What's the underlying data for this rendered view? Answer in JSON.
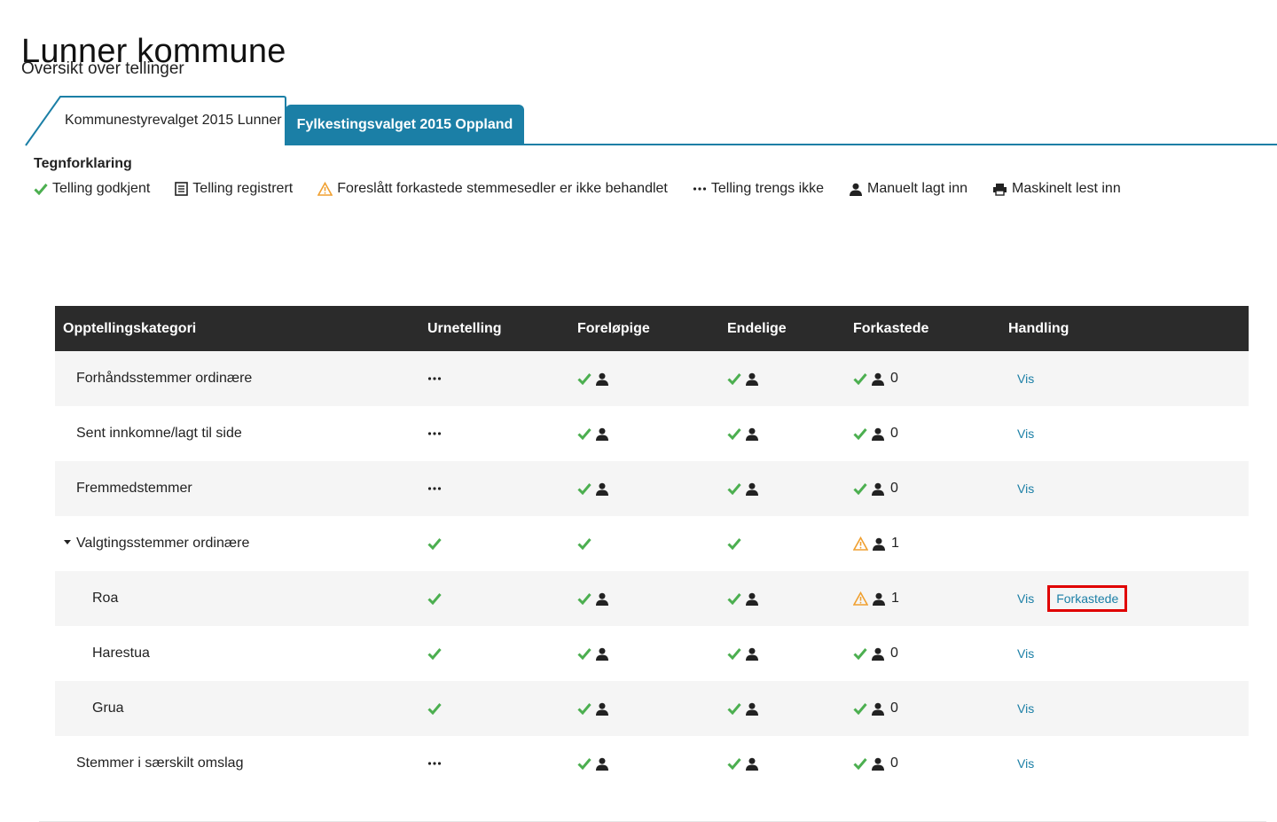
{
  "header": {
    "title": "Lunner kommune",
    "subtitle": "Oversikt over tellinger"
  },
  "tabs": [
    {
      "label": "Kommunestyrevalget 2015 Lunner",
      "active": true
    },
    {
      "label": "Fylkestingsvalget 2015 Oppland",
      "active": false
    }
  ],
  "legend": {
    "title": "Tegnforklaring",
    "items": [
      {
        "icon": "check-icon",
        "label": "Telling godkjent"
      },
      {
        "icon": "document-icon",
        "label": "Telling registrert"
      },
      {
        "icon": "warning-icon",
        "label": "Foreslått forkastede stemmesedler er ikke behandlet"
      },
      {
        "icon": "ellipsis-icon",
        "label": "Telling trengs ikke"
      },
      {
        "icon": "person-icon",
        "label": "Manuelt lagt inn"
      },
      {
        "icon": "printer-icon",
        "label": "Maskinelt lest inn"
      }
    ]
  },
  "table": {
    "columns": [
      "Opptellingskategori",
      "Urnetelling",
      "Foreløpige",
      "Endelige",
      "Forkastede",
      "Handling"
    ],
    "rows": [
      {
        "name": "Forhåndsstemmer ordinære",
        "urnetelling": "dots",
        "forelopige": "check-person",
        "endelige": "check-person",
        "forkastede_status": "check",
        "forkastede_count": "0",
        "vis": "Vis"
      },
      {
        "name": "Sent innkomne/lagt til side",
        "urnetelling": "dots",
        "forelopige": "check-person",
        "endelige": "check-person",
        "forkastede_status": "check",
        "forkastede_count": "0",
        "vis": "Vis"
      },
      {
        "name": "Fremmedstemmer",
        "urnetelling": "dots",
        "forelopige": "check-person",
        "endelige": "check-person",
        "forkastede_status": "check",
        "forkastede_count": "0",
        "vis": "Vis"
      },
      {
        "name": "Valgtingsstemmer ordinære",
        "urnetelling": "check",
        "forelopige": "check",
        "endelige": "check",
        "forkastede_status": "warning",
        "forkastede_count": "1",
        "vis": "",
        "expanded": true
      },
      {
        "name": "Roa",
        "urnetelling": "check",
        "forelopige": "check-person",
        "endelige": "check-person",
        "forkastede_status": "warning",
        "forkastede_count": "1",
        "vis": "Vis",
        "action2": "Forkastede"
      },
      {
        "name": "Harestua",
        "urnetelling": "check",
        "forelopige": "check-person",
        "endelige": "check-person",
        "forkastede_status": "check",
        "forkastede_count": "0",
        "vis": "Vis"
      },
      {
        "name": "Grua",
        "urnetelling": "check",
        "forelopige": "check-person",
        "endelige": "check-person",
        "forkastede_status": "check",
        "forkastede_count": "0",
        "vis": "Vis"
      },
      {
        "name": "Stemmer i særskilt omslag",
        "urnetelling": "dots",
        "forelopige": "check-person",
        "endelige": "check-person",
        "forkastede_status": "check",
        "forkastede_count": "0",
        "vis": "Vis"
      }
    ]
  },
  "colors": {
    "accent": "#1b7fa6",
    "check": "#4caf50",
    "warning": "#f0a030",
    "header_bg": "#2b2b2b",
    "highlight": "#e00000"
  }
}
